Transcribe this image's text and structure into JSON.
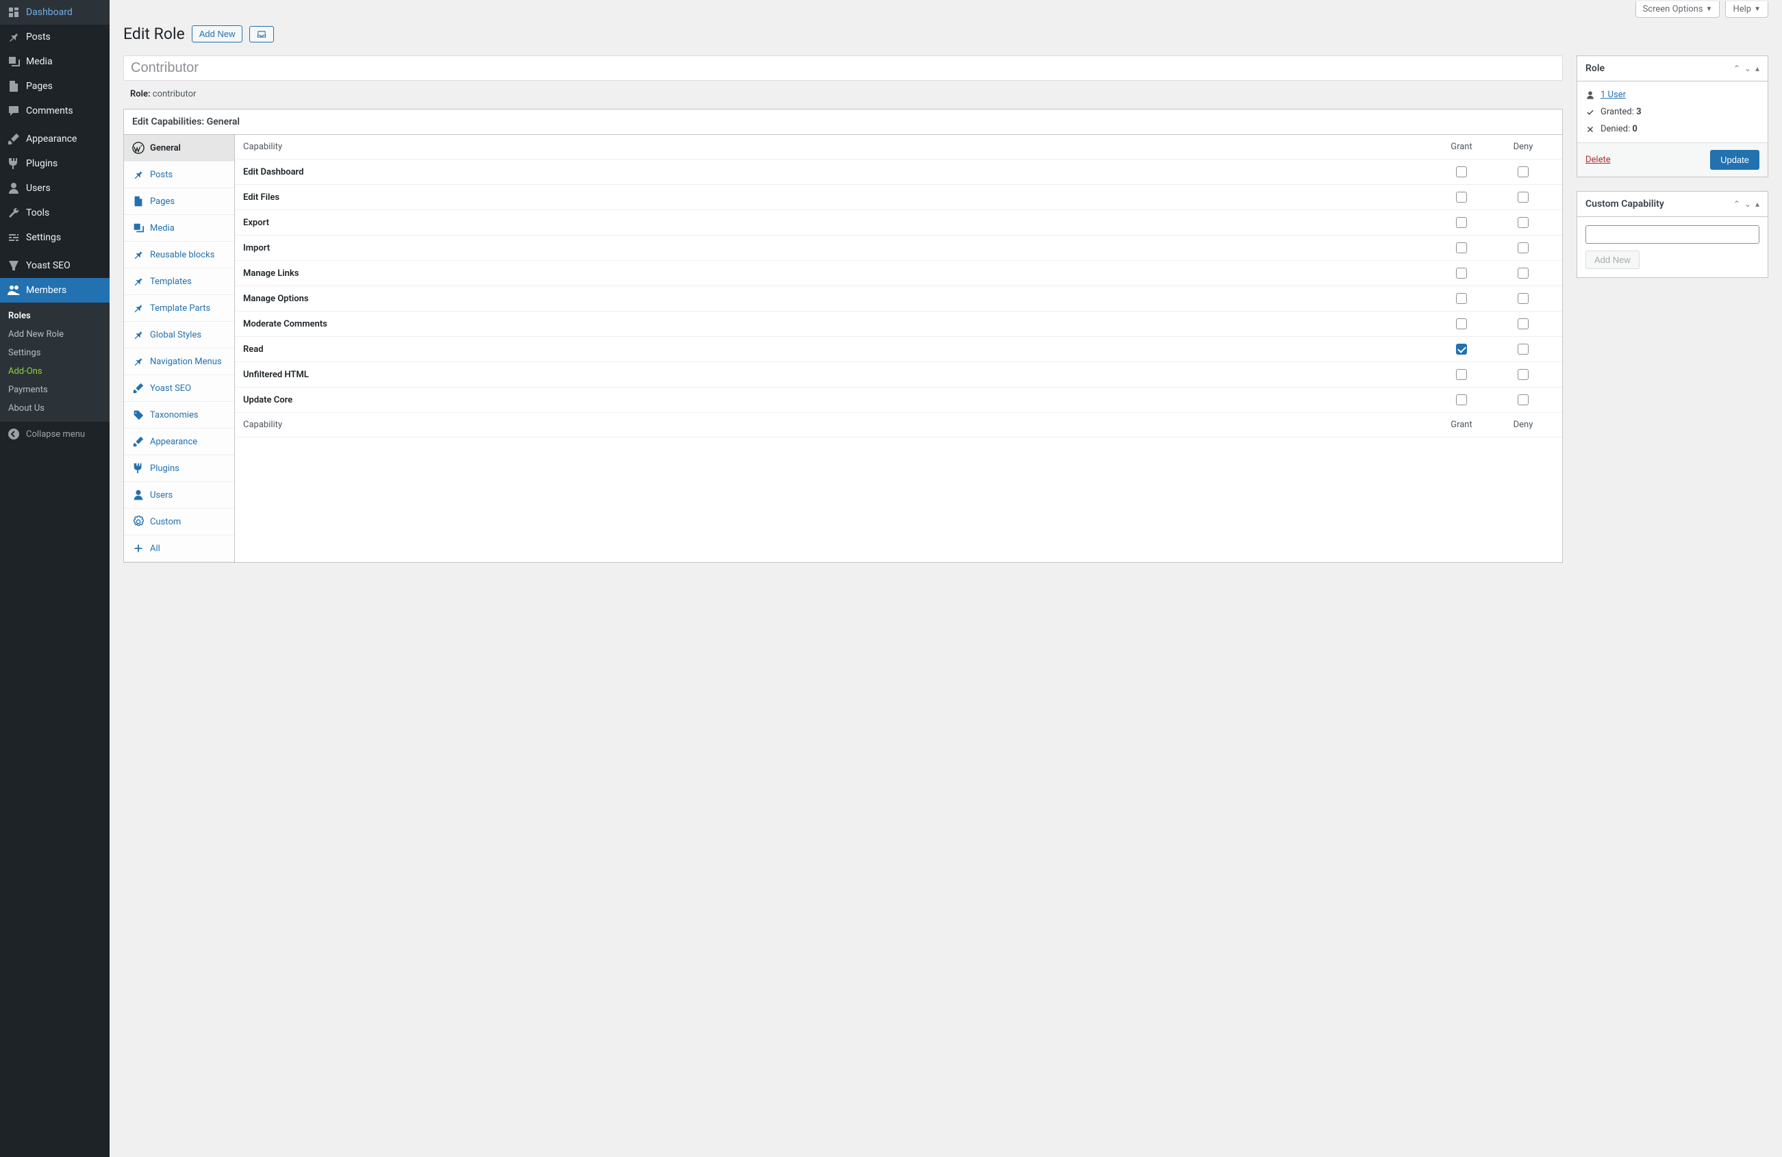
{
  "top": {
    "screen_options": "Screen Options",
    "help": "Help"
  },
  "sidebar": {
    "items": [
      {
        "label": "Dashboard",
        "icon": "dashboard"
      },
      {
        "label": "Posts",
        "icon": "pin"
      },
      {
        "label": "Media",
        "icon": "media"
      },
      {
        "label": "Pages",
        "icon": "page"
      },
      {
        "label": "Comments",
        "icon": "comment"
      },
      {
        "label": "Appearance",
        "icon": "brush"
      },
      {
        "label": "Plugins",
        "icon": "plug"
      },
      {
        "label": "Users",
        "icon": "user"
      },
      {
        "label": "Tools",
        "icon": "wrench"
      },
      {
        "label": "Settings",
        "icon": "sliders"
      },
      {
        "label": "Yoast SEO",
        "icon": "yoast"
      },
      {
        "label": "Members",
        "icon": "users",
        "active": true
      }
    ],
    "submenu": [
      {
        "label": "Roles",
        "current": true
      },
      {
        "label": "Add New Role"
      },
      {
        "label": "Settings"
      },
      {
        "label": "Add-Ons",
        "addon": true
      },
      {
        "label": "Payments"
      },
      {
        "label": "About Us"
      }
    ],
    "collapse": "Collapse menu"
  },
  "page": {
    "title": "Edit Role",
    "add_new": "Add New",
    "role_name_value": "Contributor",
    "role_label": "Role:",
    "role_slug": "contributor"
  },
  "caps": {
    "title": "Edit Capabilities: General",
    "header_capability": "Capability",
    "header_grant": "Grant",
    "header_deny": "Deny",
    "tabs": [
      {
        "label": "General",
        "icon": "wp",
        "active": true
      },
      {
        "label": "Posts",
        "icon": "pin"
      },
      {
        "label": "Pages",
        "icon": "page"
      },
      {
        "label": "Media",
        "icon": "media"
      },
      {
        "label": "Reusable blocks",
        "icon": "pin"
      },
      {
        "label": "Templates",
        "icon": "pin"
      },
      {
        "label": "Template Parts",
        "icon": "pin"
      },
      {
        "label": "Global Styles",
        "icon": "pin"
      },
      {
        "label": "Navigation Menus",
        "icon": "pin"
      },
      {
        "label": "Yoast SEO",
        "icon": "brush"
      },
      {
        "label": "Taxonomies",
        "icon": "tag"
      },
      {
        "label": "Appearance",
        "icon": "brush"
      },
      {
        "label": "Plugins",
        "icon": "plug"
      },
      {
        "label": "Users",
        "icon": "user"
      },
      {
        "label": "Custom",
        "icon": "gear"
      },
      {
        "label": "All",
        "icon": "plus"
      }
    ],
    "rows": [
      {
        "label": "Edit Dashboard",
        "grant": false,
        "deny": false
      },
      {
        "label": "Edit Files",
        "grant": false,
        "deny": false
      },
      {
        "label": "Export",
        "grant": false,
        "deny": false
      },
      {
        "label": "Import",
        "grant": false,
        "deny": false
      },
      {
        "label": "Manage Links",
        "grant": false,
        "deny": false
      },
      {
        "label": "Manage Options",
        "grant": false,
        "deny": false
      },
      {
        "label": "Moderate Comments",
        "grant": false,
        "deny": false
      },
      {
        "label": "Read",
        "grant": true,
        "deny": false
      },
      {
        "label": "Unfiltered HTML",
        "grant": false,
        "deny": false
      },
      {
        "label": "Update Core",
        "grant": false,
        "deny": false
      }
    ]
  },
  "rolebox": {
    "title": "Role",
    "users_link": "1 User",
    "granted_label": "Granted:",
    "granted_count": "3",
    "denied_label": "Denied:",
    "denied_count": "0",
    "delete": "Delete",
    "update": "Update"
  },
  "custombox": {
    "title": "Custom Capability",
    "add_new": "Add New"
  }
}
